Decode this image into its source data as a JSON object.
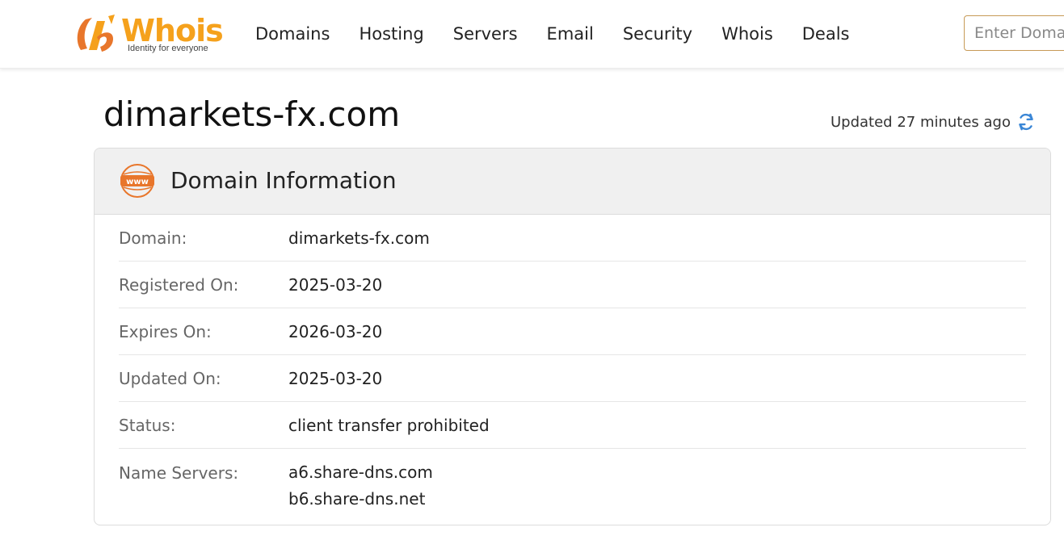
{
  "brand": {
    "name": "Whois",
    "tagline": "Identity for everyone",
    "accent": "#f5a11c",
    "accent_dark": "#e8762b"
  },
  "nav": {
    "items": [
      "Domains",
      "Hosting",
      "Servers",
      "Email",
      "Security",
      "Whois",
      "Deals"
    ]
  },
  "search": {
    "placeholder": "Enter Domain"
  },
  "page": {
    "domain_title": "dimarkets-fx.com",
    "updated_text": "Updated 27 minutes ago",
    "refresh_icon": "refresh-icon"
  },
  "card": {
    "title": "Domain Information",
    "icon": "www-icon",
    "rows": [
      {
        "label": "Domain:",
        "value": "dimarkets-fx.com"
      },
      {
        "label": "Registered On:",
        "value": "2025-03-20"
      },
      {
        "label": "Expires On:",
        "value": "2026-03-20"
      },
      {
        "label": "Updated On:",
        "value": "2025-03-20"
      },
      {
        "label": "Status:",
        "value": "client transfer prohibited"
      }
    ],
    "name_servers": {
      "label": "Name Servers:",
      "values": [
        "a6.share-dns.com",
        "b6.share-dns.net"
      ]
    }
  }
}
